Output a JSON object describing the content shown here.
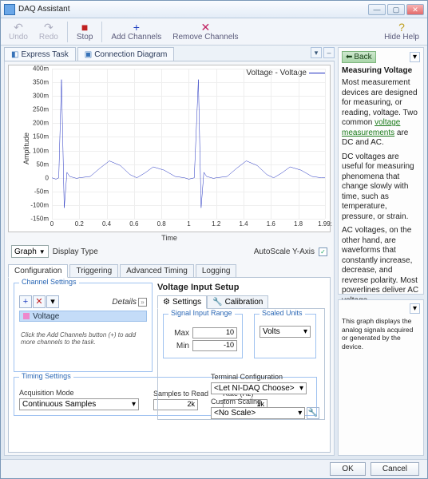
{
  "window": {
    "title": "DAQ Assistant"
  },
  "toolbar": {
    "undo": "Undo",
    "redo": "Redo",
    "stop": "Stop",
    "add": "Add Channels",
    "remove": "Remove Channels",
    "hide_help": "Hide Help"
  },
  "maintabs": {
    "express": "Express Task",
    "conn": "Connection Diagram"
  },
  "chart": {
    "ylabel": "Amplitude",
    "xlabel": "Time",
    "legend": "Voltage - Voltage",
    "display_type_label": "Display Type",
    "display_type_value": "Graph",
    "autoscale_label": "AutoScale Y-Axis"
  },
  "chart_data": {
    "type": "line",
    "title": "",
    "xlabel": "Time",
    "ylabel": "Amplitude",
    "xlim": [
      0,
      1.995
    ],
    "ylim": [
      -150,
      400
    ],
    "xticks": [
      0,
      0.2,
      0.4,
      0.6,
      0.8,
      1,
      1.2,
      1.4,
      1.6,
      1.8,
      1.995
    ],
    "xticklabels": [
      "0",
      "0.2",
      "0.4",
      "0.6",
      "0.8",
      "1",
      "1.2",
      "1.4",
      "1.6",
      "1.8",
      "1.99:"
    ],
    "yticks": [
      -150,
      -100,
      -50,
      0,
      50,
      100,
      150,
      200,
      250,
      300,
      350,
      400
    ],
    "yticklabels": [
      "-150m",
      "-100m",
      "-50m",
      "0",
      "50m",
      "100m",
      "150m",
      "200m",
      "250m",
      "300m",
      "350m",
      "400m"
    ],
    "series": [
      {
        "name": "Voltage - Voltage",
        "x": [
          0,
          0.03,
          0.05,
          0.07,
          0.09,
          0.11,
          0.13,
          0.18,
          0.2,
          0.28,
          0.35,
          0.42,
          0.5,
          0.57,
          0.62,
          0.68,
          0.74,
          0.82,
          0.9,
          0.97,
          1.0,
          1.04,
          1.07,
          1.09,
          1.11,
          1.13,
          1.18,
          1.2,
          1.28,
          1.35,
          1.42,
          1.5,
          1.57,
          1.62,
          1.68,
          1.74,
          1.82,
          1.9,
          1.97,
          1.995
        ],
        "y": [
          0,
          -5,
          0,
          360,
          -110,
          20,
          5,
          -2,
          0,
          5,
          35,
          62,
          45,
          12,
          0,
          18,
          40,
          28,
          5,
          0,
          -5,
          0,
          360,
          -110,
          20,
          5,
          -2,
          0,
          5,
          35,
          62,
          45,
          12,
          0,
          18,
          40,
          28,
          5,
          0,
          0
        ]
      }
    ]
  },
  "cfgtabs": {
    "config": "Configuration",
    "trigger": "Triggering",
    "advanced": "Advanced Timing",
    "logging": "Logging"
  },
  "channel": {
    "group": "Channel Settings",
    "details": "Details",
    "voltage_row": "Voltage",
    "hint": "Click the Add Channels button (+) to add more channels to the task."
  },
  "setup": {
    "title": "Voltage Input Setup",
    "tab_settings": "Settings",
    "tab_calibration": "Calibration",
    "range_group": "Signal Input Range",
    "max_label": "Max",
    "max_value": "10",
    "min_label": "Min",
    "min_value": "-10",
    "units_group": "Scaled Units",
    "units_value": "Volts",
    "terminal_label": "Terminal Configuration",
    "terminal_value": "<Let NI-DAQ Choose>",
    "scaling_label": "Custom Scaling",
    "scaling_value": "<No Scale>"
  },
  "timing": {
    "group": "Timing Settings",
    "mode_label": "Acquisition Mode",
    "mode_value": "Continuous Samples",
    "samples_label": "Samples to Read",
    "samples_value": "2k",
    "rate_label": "Rate (Hz)",
    "rate_value": "1k"
  },
  "help": {
    "back": "Back",
    "title": "Measuring Voltage",
    "p1": "Most measurement devices are designed for measuring, or reading, voltage. Two common ",
    "link": "voltage measurements",
    "p1b": " are DC and AC.",
    "p2": "DC voltages are useful for measuring phenomena that change slowly with time, such as temperature, pressure, or strain.",
    "p3": "AC voltages, on the other hand, are waveforms that constantly increase, decrease, and reverse polarity. Most powerlines deliver AC voltage.",
    "bottom": "This graph displays the analog signals acquired or generated by the device."
  },
  "footer": {
    "ok": "OK",
    "cancel": "Cancel"
  }
}
